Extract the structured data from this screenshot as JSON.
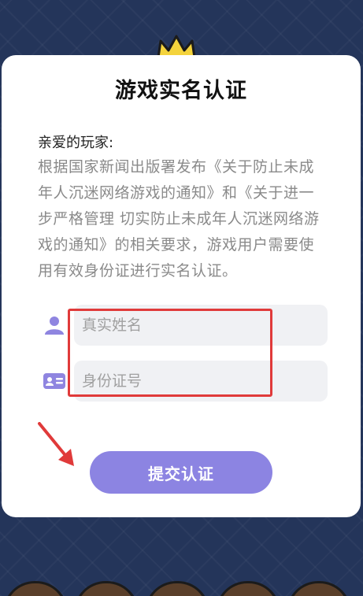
{
  "dialog": {
    "title": "游戏实名认证",
    "greeting": "亲爱的玩家:",
    "notice": "根据国家新闻出版署发布《关于防止未成年人沉迷网络游戏的通知》和《关于进一步严格管理 切实防止未成年人沉迷网络游戏的通知》的相关要求，游戏用户需要使用有效身份证进行实名认证。"
  },
  "form": {
    "name_field": {
      "placeholder": "真实姓名",
      "value": "",
      "icon": "user-icon"
    },
    "id_field": {
      "placeholder": "身份证号",
      "value": "",
      "icon": "id-card-icon"
    }
  },
  "actions": {
    "submit_label": "提交认证"
  },
  "colors": {
    "background": "#24355a",
    "accent": "#8c84e2",
    "icon": "#8f85e0",
    "highlight": "#e03a3a"
  },
  "icons": [
    "crown-icon",
    "user-icon",
    "id-card-icon",
    "arrow-icon"
  ]
}
